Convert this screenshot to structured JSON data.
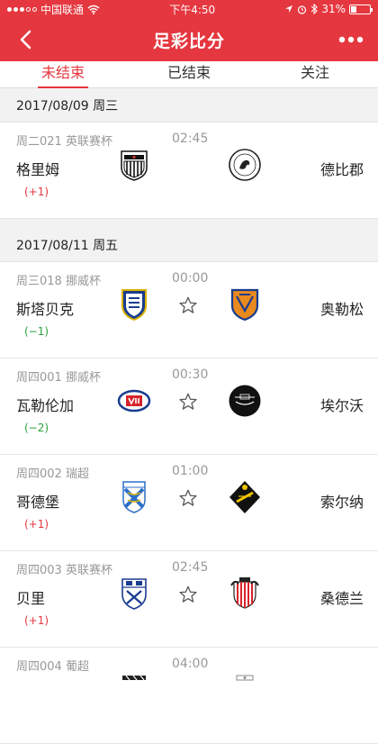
{
  "status": {
    "carrier": "中国联通",
    "time": "下午4:50",
    "battery": "31%",
    "battery_level": 0.31
  },
  "nav": {
    "title": "足彩比分"
  },
  "tabs": [
    {
      "label": "未结束",
      "active": true
    },
    {
      "label": "已结束",
      "active": false
    },
    {
      "label": "关注",
      "active": false
    }
  ],
  "dates": [
    {
      "label": "2017/08/09 周三"
    },
    {
      "label": "2017/08/11 周五"
    }
  ],
  "matches": [
    {
      "league": "周二021 英联赛杯",
      "time": "02:45",
      "home": "格里姆",
      "away": "德比郡",
      "handicap": "(+1)",
      "handicap_color": "red",
      "starred": false
    },
    {
      "league": "周三018 挪威杯",
      "time": "00:00",
      "home": "斯塔贝克",
      "away": "奥勒松",
      "handicap": "(−1)",
      "handicap_color": "green",
      "starred": true
    },
    {
      "league": "周四001 挪威杯",
      "time": "00:30",
      "home": "瓦勒伦加",
      "away": "埃尔沃",
      "handicap": "(−2)",
      "handicap_color": "green",
      "starred": true
    },
    {
      "league": "周四002 瑞超",
      "time": "01:00",
      "home": "哥德堡",
      "away": "索尔纳",
      "handicap": "(+1)",
      "handicap_color": "red",
      "starred": true
    },
    {
      "league": "周四003 英联赛杯",
      "time": "02:45",
      "home": "贝里",
      "away": "桑德兰",
      "handicap": "(+1)",
      "handicap_color": "red",
      "starred": true
    },
    {
      "league": "周四004 葡超",
      "time": "04:00",
      "home": "",
      "away": "",
      "handicap": "",
      "handicap_color": "red",
      "starred": true
    }
  ],
  "colors": {
    "brand": "#e5373f",
    "win": "#e5373f",
    "lose": "#2aa33c"
  },
  "icons": {
    "back": "back-arrow-icon",
    "more": "more-dots-icon",
    "star": "star-outline-icon",
    "location": "location-arrow-icon",
    "alarm": "alarm-icon",
    "bluetooth": "bluetooth-icon",
    "wifi": "wifi-icon"
  }
}
